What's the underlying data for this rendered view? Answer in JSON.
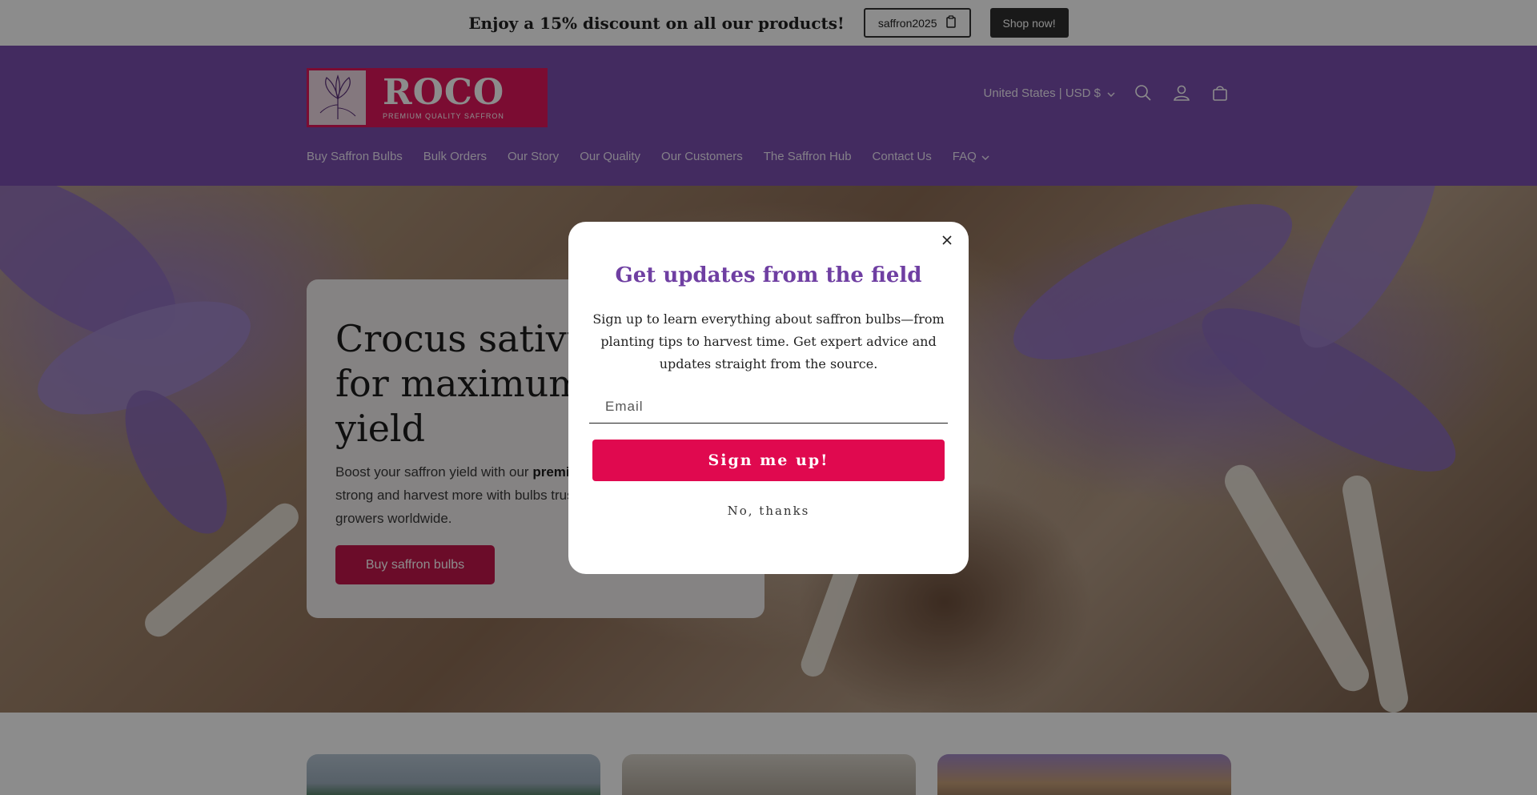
{
  "announcement": {
    "text": "Enjoy a 15% discount on all our products!",
    "code": "saffron2025",
    "shop_label": "Shop now!"
  },
  "header": {
    "logo_name": "ROCO",
    "logo_tagline": "PREMIUM QUALITY SAFFRON",
    "country_selector": "United States | USD $",
    "nav": [
      {
        "label": "Buy Saffron Bulbs"
      },
      {
        "label": "Bulk Orders"
      },
      {
        "label": "Our Story"
      },
      {
        "label": "Our Quality"
      },
      {
        "label": "Our Customers"
      },
      {
        "label": "The Saffron Hub"
      },
      {
        "label": "Contact Us"
      },
      {
        "label": "FAQ"
      }
    ]
  },
  "hero": {
    "title": "Crocus sativus bulbs for maximum saffron yield",
    "body_pre": "Boost your saffron yield with our ",
    "body_bold": "premium saffron bulbs",
    "body_post": ". Start strong and harvest more with bulbs trusted by professional saffron growers worldwide.",
    "button": "Buy saffron bulbs"
  },
  "modal": {
    "title": "Get updates from the field",
    "body": "Sign up to learn everything about saffron bulbs—from planting tips to harvest time. Get expert advice and updates straight from the source.",
    "email_placeholder": "Email",
    "signup_label": "Sign me up!",
    "decline_label": "No, thanks"
  },
  "colors": {
    "header_bg": "#7a4fb0",
    "brand_pink": "#e0175c",
    "modal_title": "#6f3fa2",
    "cta": "#e0094f"
  }
}
